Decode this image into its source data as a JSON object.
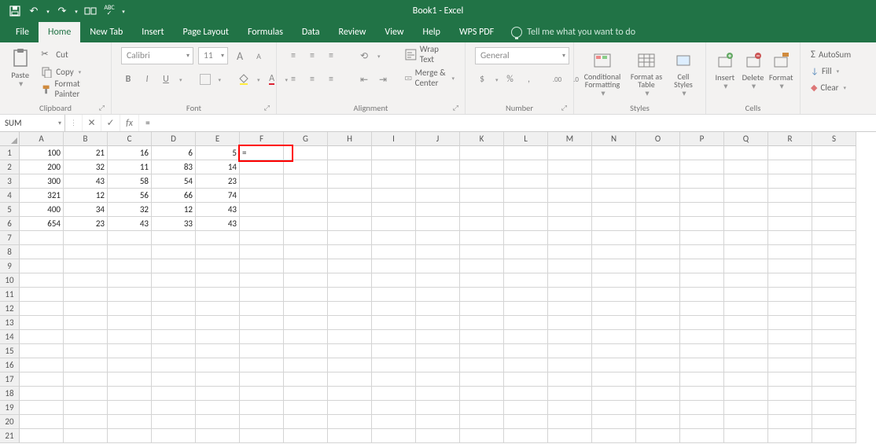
{
  "window": {
    "title": "Book1 - Excel"
  },
  "qat": {
    "save": "💾",
    "undo": "↶",
    "redo": "↷",
    "touch": "☐",
    "spell": "ABC✓"
  },
  "tabs": {
    "items": [
      "File",
      "Home",
      "New Tab",
      "Insert",
      "Page Layout",
      "Formulas",
      "Data",
      "Review",
      "View",
      "Help",
      "WPS PDF"
    ],
    "active": 1,
    "tellme": "Tell me what you want to do"
  },
  "ribbon": {
    "clipboard": {
      "label": "Clipboard",
      "paste": "Paste",
      "cut": "Cut",
      "copy": "Copy",
      "format_painter": "Format Painter"
    },
    "font": {
      "label": "Font",
      "name": "Calibri",
      "size": "11",
      "bold": "B",
      "italic": "I",
      "underline": "U",
      "inc": "A",
      "dec": "A"
    },
    "alignment": {
      "label": "Alignment",
      "wrap": "Wrap Text",
      "merge": "Merge & Center"
    },
    "number": {
      "label": "Number",
      "format": "General"
    },
    "styles": {
      "label": "Styles",
      "cond": "Conditional Formatting",
      "table": "Format as Table",
      "cell": "Cell Styles"
    },
    "cells": {
      "label": "Cells",
      "insert": "Insert",
      "delete": "Delete",
      "format": "Format"
    },
    "editing": {
      "autosum": "AutoSum",
      "fill": "Fill",
      "clear": "Clear"
    }
  },
  "formula_bar": {
    "name_box": "SUM",
    "cancel": "✕",
    "enter": "✓",
    "fx": "fx",
    "input": "="
  },
  "grid": {
    "columns": [
      "A",
      "B",
      "C",
      "D",
      "E",
      "F",
      "G",
      "H",
      "I",
      "J",
      "K",
      "L",
      "M",
      "N",
      "O",
      "P",
      "Q",
      "R",
      "S"
    ],
    "rows": 21,
    "data": [
      [
        100,
        21,
        16,
        6,
        5,
        "="
      ],
      [
        200,
        32,
        11,
        83,
        14
      ],
      [
        300,
        43,
        58,
        54,
        23
      ],
      [
        321,
        12,
        56,
        66,
        74
      ],
      [
        400,
        34,
        32,
        12,
        43
      ],
      [
        654,
        23,
        43,
        33,
        43
      ]
    ],
    "active_cell": {
      "row": 0,
      "col": 5,
      "value": "="
    }
  }
}
